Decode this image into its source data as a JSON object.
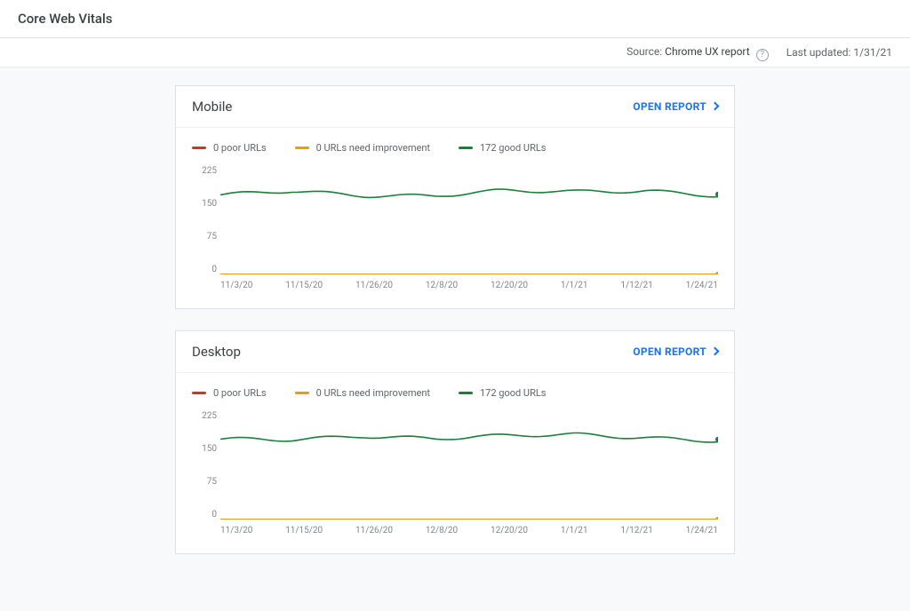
{
  "page_title": "Core Web Vitals",
  "meta": {
    "source_label": "Source:",
    "source_link_text": "Chrome UX report",
    "last_updated_label": "Last updated:",
    "last_updated_value": "1/31/21"
  },
  "open_report_label": "OPEN REPORT",
  "cards": [
    {
      "title": "Mobile",
      "legend": {
        "poor": "0 poor URLs",
        "need": "0 URLs need improvement",
        "good": "172 good URLs"
      }
    },
    {
      "title": "Desktop",
      "legend": {
        "poor": "0 poor URLs",
        "need": "0 URLs need improvement",
        "good": "172 good URLs"
      }
    }
  ],
  "axes": {
    "y_ticks": [
      "225",
      "150",
      "75",
      "0"
    ],
    "x_ticks": [
      "11/3/20",
      "11/15/20",
      "11/26/20",
      "12/8/20",
      "12/20/20",
      "1/1/21",
      "1/12/21",
      "1/24/21"
    ]
  },
  "chart_data": [
    {
      "type": "line",
      "title": "Mobile",
      "xlabel": "",
      "ylabel": "",
      "ylim": [
        0,
        225
      ],
      "categories": [
        "11/3/20",
        "11/15/20",
        "11/26/20",
        "12/8/20",
        "12/20/20",
        "1/1/21",
        "1/12/21",
        "1/24/21"
      ],
      "series": [
        {
          "name": "poor URLs",
          "color": "#d93025",
          "values": [
            0,
            0,
            0,
            0,
            0,
            0,
            0,
            0
          ]
        },
        {
          "name": "URLs need improvement",
          "color": "#f29900",
          "values": [
            0,
            0,
            0,
            0,
            0,
            0,
            0,
            0
          ]
        },
        {
          "name": "good URLs",
          "color": "#188038",
          "values": [
            168,
            180,
            172,
            170,
            178,
            175,
            180,
            172
          ]
        }
      ]
    },
    {
      "type": "line",
      "title": "Desktop",
      "xlabel": "",
      "ylabel": "",
      "ylim": [
        0,
        225
      ],
      "categories": [
        "11/3/20",
        "11/15/20",
        "11/26/20",
        "12/8/20",
        "12/20/20",
        "1/1/21",
        "1/12/21",
        "1/24/21"
      ],
      "series": [
        {
          "name": "poor URLs",
          "color": "#d93025",
          "values": [
            0,
            0,
            0,
            0,
            0,
            0,
            0,
            0
          ]
        },
        {
          "name": "URLs need improvement",
          "color": "#f29900",
          "values": [
            0,
            0,
            0,
            0,
            0,
            0,
            0,
            0
          ]
        },
        {
          "name": "good URLs",
          "color": "#188038",
          "values": [
            170,
            172,
            182,
            175,
            178,
            180,
            176,
            172
          ]
        }
      ]
    }
  ]
}
